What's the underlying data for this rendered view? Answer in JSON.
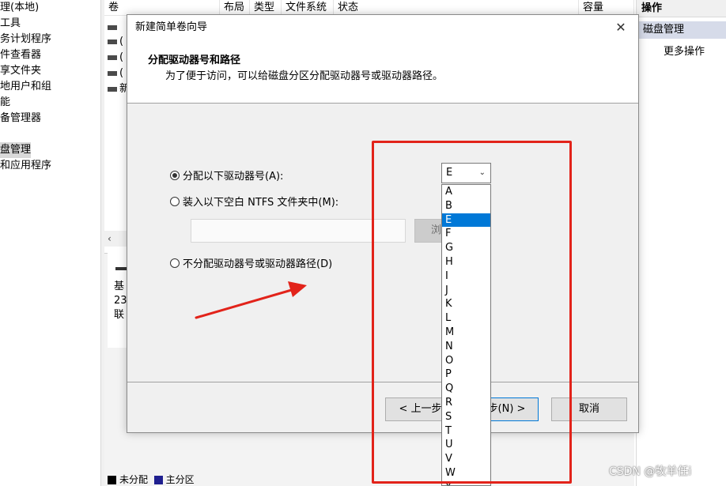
{
  "tree": {
    "items": [
      "理(本地)",
      "工具",
      "务计划程序",
      "件查看器",
      "享文件夹",
      "地用户和组",
      "能",
      "备管理器",
      "",
      "盘管理",
      "和应用程序"
    ]
  },
  "volumes": {
    "columns": [
      "卷",
      "布局",
      "类型",
      "文件系统",
      "状态",
      "容量"
    ],
    "rows": [
      "(",
      "(",
      "(",
      "新"
    ]
  },
  "disk": {
    "lines": [
      "基",
      "23",
      "联"
    ]
  },
  "legend": {
    "items": [
      {
        "label": "未分配",
        "color": "#000000"
      },
      {
        "label": "主分区",
        "color": "#1f1f8f"
      }
    ]
  },
  "actions": {
    "title": "操作",
    "selected": "磁盘管理",
    "more": "更多操作"
  },
  "wizard": {
    "title": "新建简单卷向导",
    "close_icon": "✕",
    "heading": "分配驱动器号和路径",
    "subheading": "为了便于访问，可以给磁盘分区分配驱动器号或驱动器路径。",
    "options": {
      "assign_letter": "分配以下驱动器号(A):",
      "mount_folder": "装入以下空白 NTFS 文件夹中(M):",
      "no_assign": "不分配驱动器号或驱动器路径(D)"
    },
    "browse_label": "浏",
    "back_label": "< 上一步(",
    "next_label": "一步(N) >",
    "cancel_label": "取消"
  },
  "drive_select": {
    "value": "E",
    "options": [
      "A",
      "B",
      "E",
      "F",
      "G",
      "H",
      "I",
      "J",
      "K",
      "L",
      "M",
      "N",
      "O",
      "P",
      "Q",
      "R",
      "S",
      "T",
      "U",
      "V",
      "W",
      "Y"
    ],
    "selected_index": 2
  },
  "colors": {
    "annotation": "#e2231a",
    "selection": "#0078d7"
  },
  "watermark": "CSDN @牧羊任i"
}
